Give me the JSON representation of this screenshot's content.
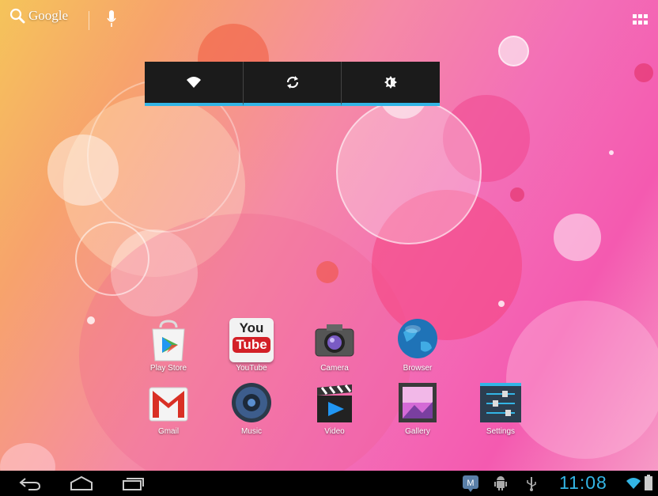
{
  "search": {
    "label": "Google"
  },
  "apps_row1": [
    {
      "label": "Play Store"
    },
    {
      "label": "YouTube",
      "icon_text_top": "You",
      "icon_text_bottom": "Tube"
    },
    {
      "label": "Camera"
    },
    {
      "label": "Browser"
    }
  ],
  "apps_row2": [
    {
      "label": "Gmail"
    },
    {
      "label": "Music"
    },
    {
      "label": "Video"
    },
    {
      "label": "Gallery"
    },
    {
      "label": "Settings"
    }
  ],
  "status": {
    "time": "11:08"
  },
  "colors": {
    "accent": "#33b5e5",
    "navbar": "#000000",
    "widget": "#1b1b1b"
  },
  "icons": [
    "search-icon",
    "mic-icon",
    "apps-grid-icon",
    "wifi-icon",
    "sync-icon",
    "brightness-icon",
    "back-icon",
    "home-icon",
    "recents-icon",
    "notification-icon",
    "android-debug-icon",
    "usb-icon",
    "wifi-signal-icon",
    "battery-icon"
  ]
}
